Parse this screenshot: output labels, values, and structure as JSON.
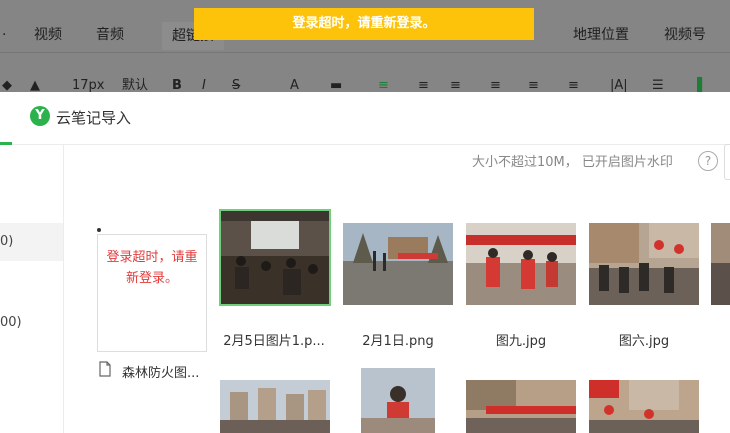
{
  "editor": {
    "tabs": [
      "视频",
      "音频",
      "超链接",
      "地理位置",
      "视频号"
    ],
    "toolbar": {
      "font_size": "17px",
      "font_default": "默认"
    }
  },
  "banner": {
    "text": "登录超时，请重新登录。",
    "color": "#fdc20a"
  },
  "dialog": {
    "title": "云笔记导入",
    "logo_letter": "Y",
    "hint": "大小不超过10M， 已开启图片水印",
    "help": "?",
    "sidebar": {
      "items": [
        "0)",
        "00)"
      ]
    },
    "error_card": {
      "text": "登录超时，请重新登录。"
    },
    "file": {
      "name": "森林防火图..."
    },
    "images": [
      {
        "caption": "2月5日图片1.p...",
        "selected": true
      },
      {
        "caption": "2月1日.png",
        "selected": false
      },
      {
        "caption": "图九.jpg",
        "selected": false
      },
      {
        "caption": "图六.jpg",
        "selected": false
      }
    ]
  },
  "colors": {
    "accent": "#2bb24c",
    "error": "#e23b3b"
  }
}
